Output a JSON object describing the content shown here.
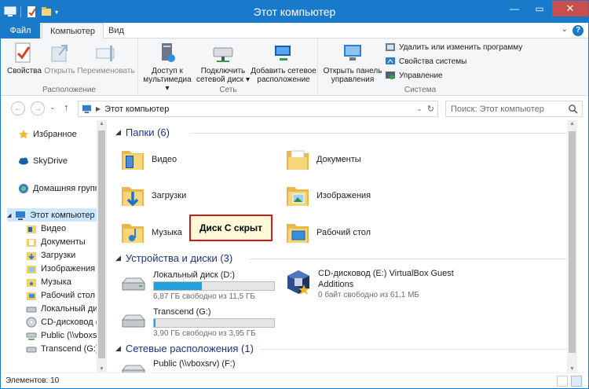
{
  "window": {
    "title": "Этот компьютер"
  },
  "tabs": {
    "file": "Файл",
    "computer": "Компьютер",
    "view": "Вид"
  },
  "ribbon": {
    "location_group": {
      "label": "Расположение",
      "properties": "Свойства",
      "open": "Открыть",
      "rename": "Переименовать"
    },
    "network_group": {
      "label": "Сеть",
      "media_access_l1": "Доступ к",
      "media_access_l2": "мультимедиа",
      "map_drive_l1": "Подключить",
      "map_drive_l2": "сетевой диск",
      "add_location_l1": "Добавить сетевое",
      "add_location_l2": "расположение"
    },
    "system_group": {
      "label": "Система",
      "control_panel_l1": "Открыть панель",
      "control_panel_l2": "управления",
      "uninstall": "Удалить или изменить программу",
      "system_props": "Свойства системы",
      "manage": "Управление"
    }
  },
  "address": {
    "path": "Этот компьютер",
    "search_placeholder": "Поиск: Этот компьютер"
  },
  "nav": {
    "favorites": "Избранное",
    "skydrive": "SkyDrive",
    "homegroup": "Домашняя группа",
    "this_pc": "Этот компьютер",
    "children": [
      "Видео",
      "Документы",
      "Загрузки",
      "Изображения",
      "Музыка",
      "Рабочий стол",
      "Локальный диск",
      "CD-дисковод (E:",
      "Public (\\\\vboxsrv",
      "Transcend (G:)"
    ]
  },
  "content": {
    "folders_header": "Папки (6)",
    "folders": [
      "Видео",
      "Документы",
      "Загрузки",
      "Изображения",
      "Музыка",
      "Рабочий стол"
    ],
    "devices_header": "Устройства и диски (3)",
    "drives": [
      {
        "name": "Локальный диск (D:)",
        "free": "6,87 ГБ свободно из 11,5 ГБ",
        "used_fraction": 0.4
      },
      {
        "name": "CD-дисковод (E:) VirtualBox Guest",
        "name2": "Additions",
        "free": "0 байт свободно из 61,1 МБ"
      },
      {
        "name": "Transcend (G:)",
        "free": "3,90 ГБ свободно из 3,95 ГБ",
        "used_fraction": 0.013
      }
    ],
    "network_header": "Сетевые расположения (1)",
    "network_items": [
      "Public (\\\\vboxsrv) (F:)"
    ],
    "callout": "Диск С скрыт"
  },
  "status": {
    "items": "Элементов: 10"
  },
  "colors": {
    "accent": "#1979ca",
    "close": "#c7504f",
    "callout_border": "#c81e1e"
  }
}
